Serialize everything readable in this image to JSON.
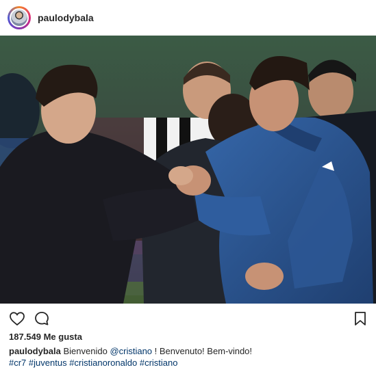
{
  "post": {
    "username": "paulodybala",
    "likes": "187.549 Me gusta",
    "caption": {
      "username": "paulodybala",
      "text_before": "Bienvenido ",
      "mention": "@cristiano",
      "text_after": " ! Benvenuto! Bem-vindo!",
      "hashtags": [
        "#cr7",
        "#juventus",
        "#cristianoronaldo",
        "#cristiano"
      ]
    }
  },
  "icons": {
    "like": "heart-outline-icon",
    "comment": "comment-bubble-icon",
    "save": "bookmark-icon"
  },
  "colors": {
    "text": "#262626",
    "link": "#003569",
    "ronaldo_jacket": "#2c5694"
  }
}
